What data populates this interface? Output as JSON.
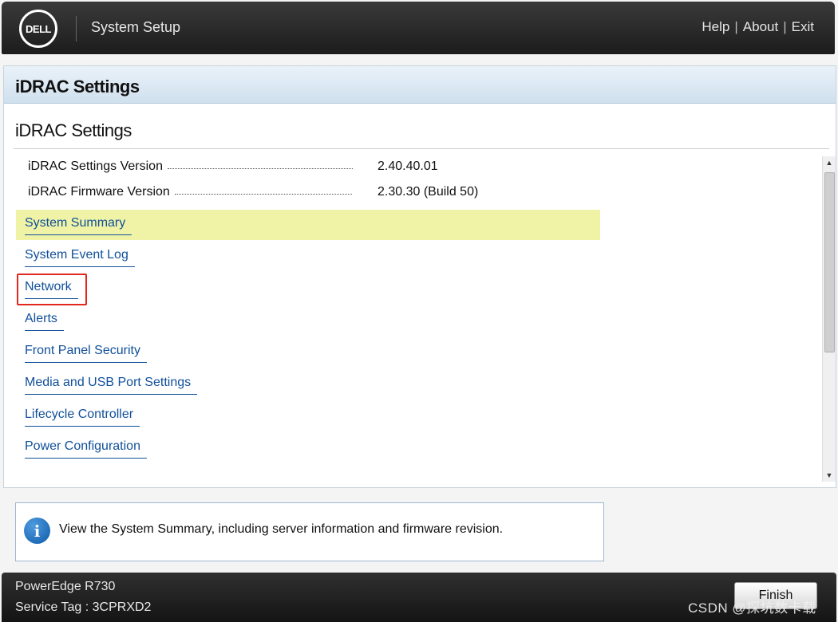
{
  "header": {
    "logo_text": "DELL",
    "title": "System Setup",
    "links": {
      "help": "Help",
      "about": "About",
      "exit": "Exit"
    },
    "separator": "|"
  },
  "panel": {
    "title": "iDRAC Settings",
    "section_heading": "iDRAC Settings",
    "info_rows": [
      {
        "label": "iDRAC Settings Version",
        "value": "2.40.40.01"
      },
      {
        "label": "iDRAC Firmware Version",
        "value": "2.30.30 (Build 50)"
      }
    ],
    "menu_items": [
      {
        "label": "System Summary",
        "highlighted": true
      },
      {
        "label": "System Event Log"
      },
      {
        "label": "Network",
        "focused": true
      },
      {
        "label": "Alerts"
      },
      {
        "label": "Front Panel Security"
      },
      {
        "label": "Media and USB Port Settings"
      },
      {
        "label": "Lifecycle Controller"
      },
      {
        "label": "Power Configuration"
      }
    ]
  },
  "help": {
    "icon": "info-icon",
    "icon_glyph": "i",
    "text": "View the System Summary, including server information and firmware revision."
  },
  "footer": {
    "model": "PowerEdge R730",
    "service_tag": "Service Tag : 3CPRXD2",
    "finish_label": "Finish"
  },
  "watermark": "CSDN @探坑数卡载",
  "colors": {
    "highlight": "#f0f3a6",
    "link": "#10509a",
    "focus_box": "#e0281e",
    "header_bg": "#1c1c1c"
  }
}
